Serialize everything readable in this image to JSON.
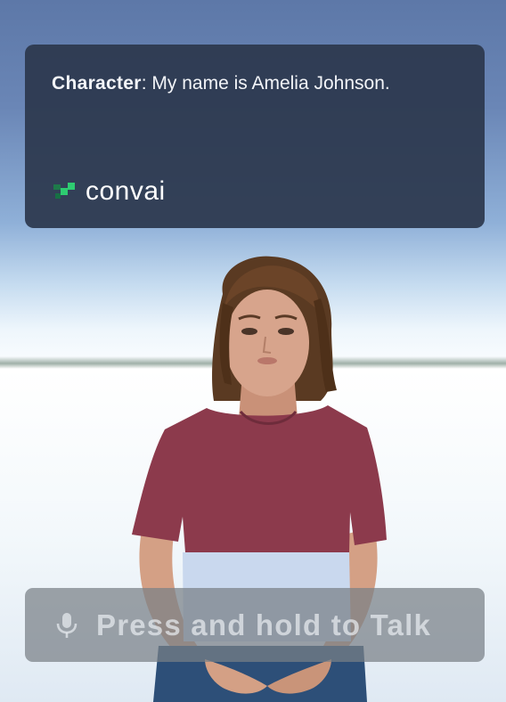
{
  "chat": {
    "speaker": "Character",
    "separator": ": ",
    "message": "My name is Amelia Johnson."
  },
  "brand": {
    "name": "convai",
    "icon": "convai-logo-icon",
    "accent": "#2ecc71"
  },
  "talk_button": {
    "label": "Press and hold to Talk",
    "icon": "microphone-icon"
  },
  "colors": {
    "panel": "#2c384e",
    "shirt_top": "#8c3a4c",
    "shirt_bottom": "#c9d8ee",
    "pants": "#2d4f78"
  }
}
